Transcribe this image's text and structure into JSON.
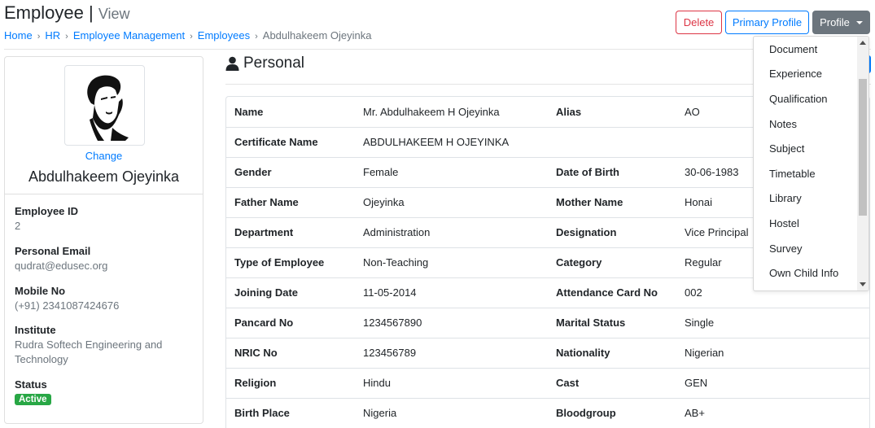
{
  "header": {
    "title": "Employee",
    "separator": "|",
    "subtitle": "View"
  },
  "breadcrumb": {
    "items": [
      "Home",
      "HR",
      "Employee Management",
      "Employees"
    ],
    "current": "Abdulhakeem Ojeyinka",
    "separator": "›"
  },
  "toolbar": {
    "delete_label": "Delete",
    "primary_profile_label": "Primary Profile",
    "profile_label": "Profile"
  },
  "profile_menu": {
    "items": [
      "Document",
      "Experience",
      "Qualification",
      "Notes",
      "Subject",
      "Timetable",
      "Library",
      "Hostel",
      "Survey",
      "Own Child Info"
    ]
  },
  "profile_card": {
    "change_label": "Change",
    "name": "Abdulhakeem Ojeyinka",
    "fields": [
      {
        "label": "Employee ID",
        "value": "2"
      },
      {
        "label": "Personal Email",
        "value": "qudrat@edusec.org"
      },
      {
        "label": "Mobile No",
        "value": "(+91) 2341087424676"
      },
      {
        "label": "Institute",
        "value": "Rudra Softech Engineering and Technology"
      }
    ],
    "status_label": "Status",
    "status_value": "Active",
    "status_color": "#28a745"
  },
  "section": {
    "icon": "user-icon",
    "title": "Personal"
  },
  "details": {
    "rows": [
      {
        "k1": "Name",
        "v1": "Mr. Abdulhakeem H Ojeyinka",
        "k2": "Alias",
        "v2": "AO"
      },
      {
        "k1": "Certificate Name",
        "v1": "ABDULHAKEEM H OJEYINKA",
        "k2": "",
        "v2": ""
      },
      {
        "k1": "Gender",
        "v1": "Female",
        "k2": "Date of Birth",
        "v2": "30-06-1983"
      },
      {
        "k1": "Father Name",
        "v1": "Ojeyinka",
        "k2": "Mother Name",
        "v2": "Honai"
      },
      {
        "k1": "Department",
        "v1": "Administration",
        "k2": "Designation",
        "v2": "Vice Principal"
      },
      {
        "k1": "Type of Employee",
        "v1": "Non-Teaching",
        "k2": "Category",
        "v2": "Regular"
      },
      {
        "k1": "Joining Date",
        "v1": "11-05-2014",
        "k2": "Attendance Card No",
        "v2": "002"
      },
      {
        "k1": "Pancard No",
        "v1": "1234567890",
        "k2": "Marital Status",
        "v2": "Single"
      },
      {
        "k1": "NRIC No",
        "v1": "123456789",
        "k2": "Nationality",
        "v2": "Nigerian"
      },
      {
        "k1": "Religion",
        "v1": "Hindu",
        "k2": "Cast",
        "v2": "GEN"
      },
      {
        "k1": "Birth Place",
        "v1": "Nigeria",
        "k2": "Bloodgroup",
        "v2": "AB+"
      }
    ]
  },
  "colors": {
    "link": "#007bff",
    "danger": "#dc3545",
    "secondary": "#6c757d",
    "success": "#28a745"
  }
}
